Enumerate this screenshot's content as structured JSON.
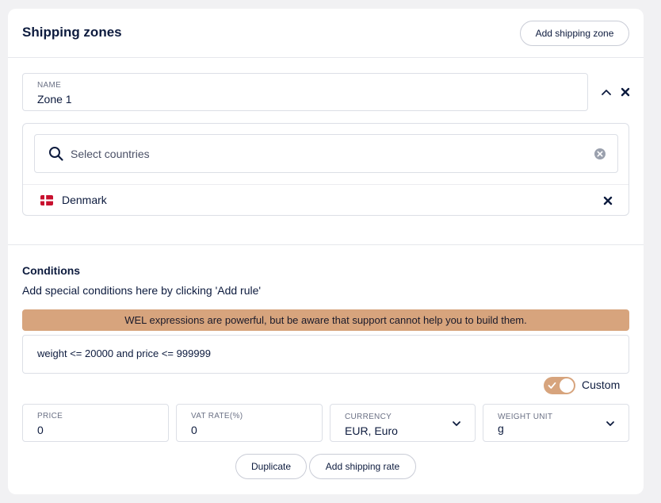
{
  "header": {
    "title": "Shipping zones",
    "add_zone_label": "Add shipping zone"
  },
  "zone": {
    "name_label": "NAME",
    "name_value": "Zone 1"
  },
  "countries": {
    "search_placeholder": "Select countries",
    "items": [
      {
        "name": "Denmark",
        "flag": "dk-flag-icon"
      }
    ]
  },
  "conditions": {
    "title": "Conditions",
    "description": "Add special conditions here by clicking 'Add rule'",
    "warning": "WEL expressions are powerful, but be aware that support cannot help you to build them.",
    "expression": "weight <= 20000 and price <= 999999",
    "custom_label": "Custom",
    "custom_enabled": true
  },
  "rate": {
    "price_label": "PRICE",
    "price_value": "0",
    "vat_label": "VAT RATE(%)",
    "vat_value": "0",
    "currency_label": "CURRENCY",
    "currency_value": "EUR, Euro",
    "weight_label": "WEIGHT UNIT",
    "weight_value": "g"
  },
  "actions": {
    "duplicate_label": "Duplicate",
    "add_rate_label": "Add shipping rate"
  },
  "colors": {
    "accent": "#d7a47d",
    "text": "#0d1b3e",
    "flag_red": "#c8102e"
  }
}
